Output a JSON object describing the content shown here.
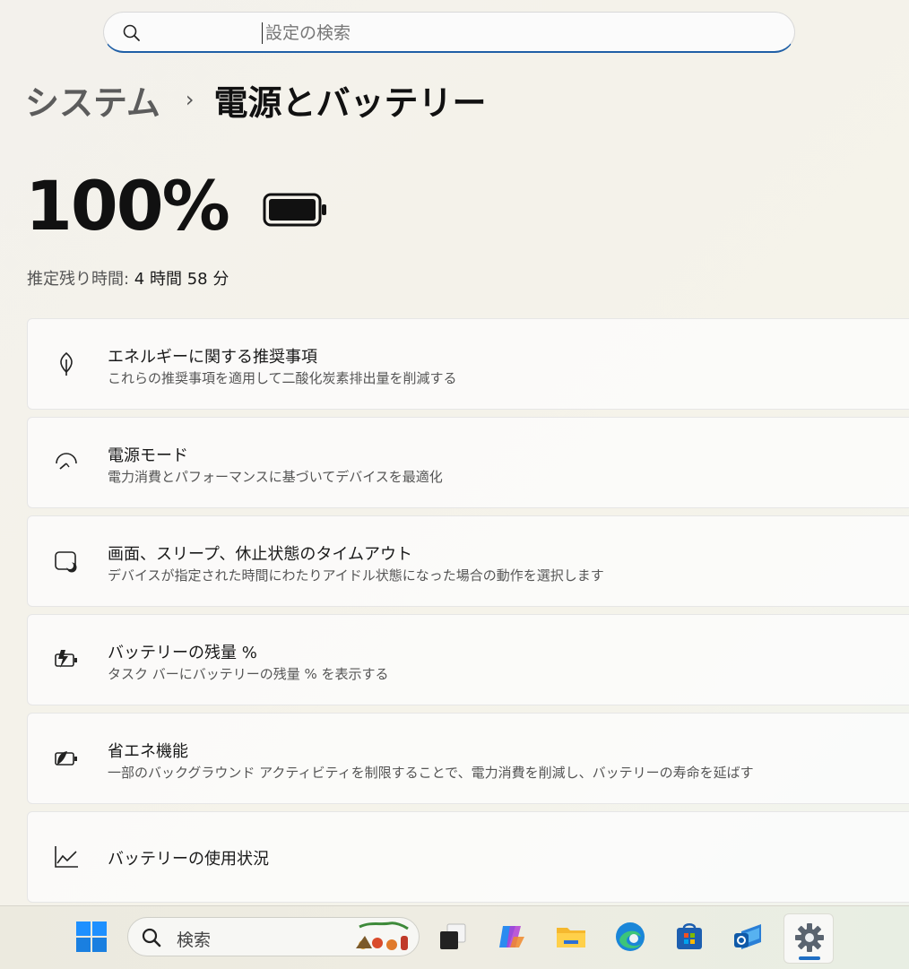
{
  "search": {
    "placeholder": "設定の検索",
    "icon": "search-icon"
  },
  "breadcrumb": {
    "parent": "システム",
    "separator": "›",
    "current": "電源とバッテリー"
  },
  "battery": {
    "percent_label": "100%",
    "level": 1.0,
    "icon": "battery-full-icon"
  },
  "remaining": {
    "label": "推定残り時間: ",
    "value": "4 時間 58 分"
  },
  "cards": [
    {
      "title": "エネルギーに関する推奨事項",
      "desc": "これらの推奨事項を適用して二酸化炭素排出量を削減する",
      "icon": "leaf-icon"
    },
    {
      "title": "電源モード",
      "desc": "電力消費とパフォーマンスに基づいてデバイスを最適化",
      "icon": "gauge-icon"
    },
    {
      "title": "画面、スリープ、休止状態のタイムアウト",
      "desc": "デバイスが指定された時間にわたりアイドル状態になった場合の動作を選択します",
      "icon": "screen-sleep-icon"
    },
    {
      "title": "バッテリーの残量 %",
      "desc": "タスク バーにバッテリーの残量 % を表示する",
      "icon": "battery-charge-icon"
    },
    {
      "title": "省エネ機能",
      "desc": "一部のバックグラウンド アクティビティを制限することで、電力消費を削減し、バッテリーの寿命を延ばす",
      "icon": "battery-saver-icon"
    },
    {
      "title": "バッテリーの使用状況",
      "icon": "chart-line-icon"
    }
  ],
  "taskbar": {
    "search_label": "検索",
    "apps": [
      "windows-start-icon",
      "task-view-icon",
      "copilot-icon",
      "file-explorer-icon",
      "edge-icon",
      "store-icon",
      "outlook-icon",
      "settings-icon"
    ]
  },
  "colors": {
    "accent": "#1f5fa6",
    "taskbar_active": "#1f6fc4"
  }
}
